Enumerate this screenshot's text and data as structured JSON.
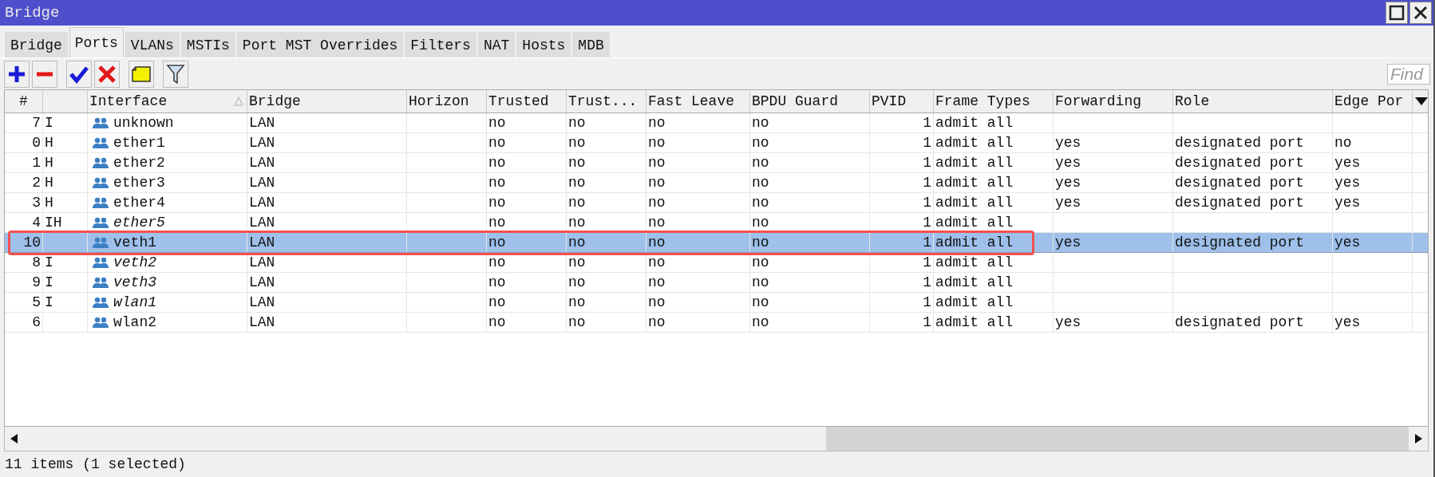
{
  "window": {
    "title": "Bridge"
  },
  "tabs": [
    {
      "label": "Bridge",
      "selected": false
    },
    {
      "label": "Ports",
      "selected": true
    },
    {
      "label": "VLANs",
      "selected": false
    },
    {
      "label": "MSTIs",
      "selected": false
    },
    {
      "label": "Port MST Overrides",
      "selected": false
    },
    {
      "label": "Filters",
      "selected": false
    },
    {
      "label": "NAT",
      "selected": false
    },
    {
      "label": "Hosts",
      "selected": false
    },
    {
      "label": "MDB",
      "selected": false
    }
  ],
  "toolbar": {
    "find": {
      "placeholder": "Find"
    }
  },
  "table": {
    "columns": [
      {
        "label": "#",
        "sorted": false
      },
      {
        "sorted": false
      },
      {
        "label": "Interface",
        "sorted": true
      },
      {
        "label": "Bridge",
        "sorted": false
      },
      {
        "label": "Horizon",
        "sorted": false
      },
      {
        "label": "Trusted",
        "sorted": false
      },
      {
        "label": "Trust...",
        "sorted": false
      },
      {
        "label": "Fast Leave",
        "sorted": false
      },
      {
        "label": "BPDU Guard",
        "sorted": false
      },
      {
        "label": "PVID",
        "sorted": false
      },
      {
        "label": "Frame Types",
        "sorted": false
      },
      {
        "label": "Forwarding",
        "sorted": false
      },
      {
        "label": "Role",
        "sorted": false
      },
      {
        "label": "Edge Por",
        "sorted": false
      }
    ],
    "rows": [
      {
        "number": "7",
        "flags": "I",
        "interface": "unknown",
        "inactive": false,
        "bridge": "LAN",
        "trusted": "no",
        "trust": "no",
        "fast_leave": "no",
        "bpdu_guard": "no",
        "pvid": "1",
        "frame_types": "admit all",
        "selected": false
      },
      {
        "number": "0",
        "flags": "H",
        "interface": "ether1",
        "inactive": false,
        "bridge": "LAN",
        "trusted": "no",
        "trust": "no",
        "fast_leave": "no",
        "bpdu_guard": "no",
        "pvid": "1",
        "frame_types": "admit all",
        "forwarding": "yes",
        "role": "designated port",
        "edge_port": "no",
        "selected": false
      },
      {
        "number": "1",
        "flags": "H",
        "interface": "ether2",
        "inactive": false,
        "bridge": "LAN",
        "trusted": "no",
        "trust": "no",
        "fast_leave": "no",
        "bpdu_guard": "no",
        "pvid": "1",
        "frame_types": "admit all",
        "forwarding": "yes",
        "role": "designated port",
        "edge_port": "yes",
        "selected": false
      },
      {
        "number": "2",
        "flags": "H",
        "interface": "ether3",
        "inactive": false,
        "bridge": "LAN",
        "trusted": "no",
        "trust": "no",
        "fast_leave": "no",
        "bpdu_guard": "no",
        "pvid": "1",
        "frame_types": "admit all",
        "forwarding": "yes",
        "role": "designated port",
        "edge_port": "yes",
        "selected": false
      },
      {
        "number": "3",
        "flags": "H",
        "interface": "ether4",
        "inactive": false,
        "bridge": "LAN",
        "trusted": "no",
        "trust": "no",
        "fast_leave": "no",
        "bpdu_guard": "no",
        "pvid": "1",
        "frame_types": "admit all",
        "forwarding": "yes",
        "role": "designated port",
        "edge_port": "yes",
        "selected": false
      },
      {
        "number": "4",
        "flags": "IH",
        "interface": "ether5",
        "inactive": true,
        "bridge": "LAN",
        "trusted": "no",
        "trust": "no",
        "fast_leave": "no",
        "bpdu_guard": "no",
        "pvid": "1",
        "frame_types": "admit all",
        "selected": false
      },
      {
        "number": "10",
        "interface": "veth1",
        "inactive": false,
        "bridge": "LAN",
        "trusted": "no",
        "trust": "no",
        "fast_leave": "no",
        "bpdu_guard": "no",
        "pvid": "1",
        "frame_types": "admit all",
        "forwarding": "yes",
        "role": "designated port",
        "edge_port": "yes",
        "selected": true
      },
      {
        "number": "8",
        "flags": "I",
        "interface": "veth2",
        "inactive": true,
        "bridge": "LAN",
        "trusted": "no",
        "trust": "no",
        "fast_leave": "no",
        "bpdu_guard": "no",
        "pvid": "1",
        "frame_types": "admit all",
        "selected": false
      },
      {
        "number": "9",
        "flags": "I",
        "interface": "veth3",
        "inactive": true,
        "bridge": "LAN",
        "trusted": "no",
        "trust": "no",
        "fast_leave": "no",
        "bpdu_guard": "no",
        "pvid": "1",
        "frame_types": "admit all",
        "selected": false
      },
      {
        "number": "5",
        "flags": "I",
        "interface": "wlan1",
        "inactive": true,
        "bridge": "LAN",
        "trusted": "no",
        "trust": "no",
        "fast_leave": "no",
        "bpdu_guard": "no",
        "pvid": "1",
        "frame_types": "admit all",
        "selected": false
      },
      {
        "number": "6",
        "interface": "wlan2",
        "inactive": false,
        "bridge": "LAN",
        "trusted": "no",
        "trust": "no",
        "fast_leave": "no",
        "bpdu_guard": "no",
        "pvid": "1",
        "frame_types": "admit all",
        "forwarding": "yes",
        "role": "designated port",
        "edge_port": "yes",
        "selected": false
      }
    ],
    "annotation": {
      "kind": "highlight-box"
    }
  },
  "status_bar": {
    "text": "11 items (1 selected)"
  }
}
